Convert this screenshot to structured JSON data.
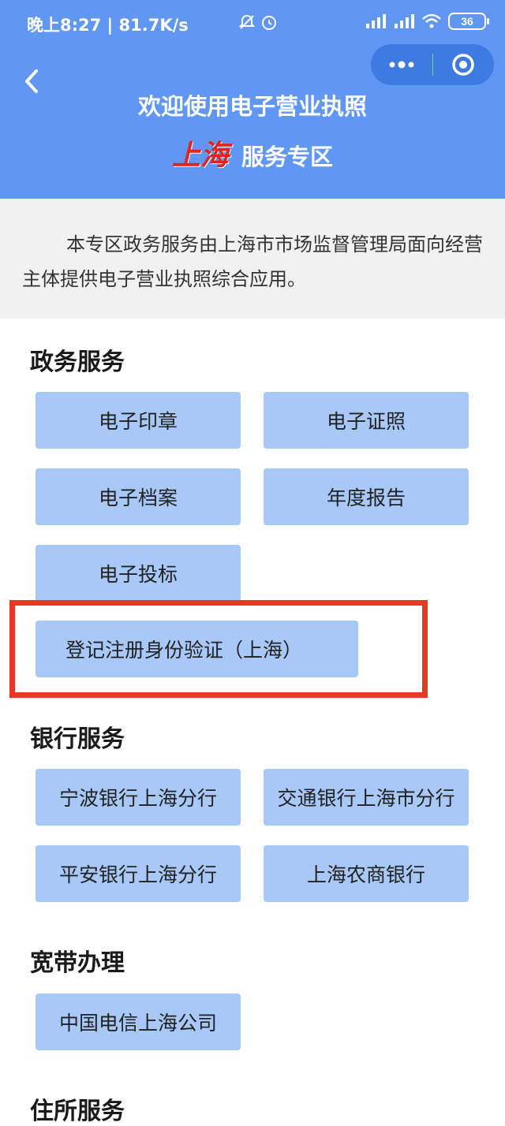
{
  "status_bar": {
    "time_text": "晚上8:27 | 81.7K/s",
    "battery": "36"
  },
  "header": {
    "title": "欢迎使用电子营业执照",
    "city": "上海",
    "zone": "服务专区"
  },
  "intro": {
    "text": "本专区政务服务由上海市市场监督管理局面向经营主体提供电子营业执照综合应用。"
  },
  "sections": {
    "government": {
      "title": "政务服务",
      "items": [
        "电子印章",
        "电子证照",
        "电子档案",
        "年度报告",
        "电子投标",
        "登记注册身份验证（上海）"
      ]
    },
    "bank": {
      "title": "银行服务",
      "items": [
        "宁波银行上海分行",
        "交通银行上海市分行",
        "平安银行上海分行",
        "上海农商银行"
      ]
    },
    "broadband": {
      "title": "宽带办理",
      "items": [
        "中国电信上海公司"
      ]
    },
    "residence": {
      "title": "住所服务"
    }
  },
  "colors": {
    "header_bg": "#5f97f2",
    "button_bg": "#a8c8f7",
    "highlight_border": "#e33b22",
    "city_red": "#e8201d"
  }
}
